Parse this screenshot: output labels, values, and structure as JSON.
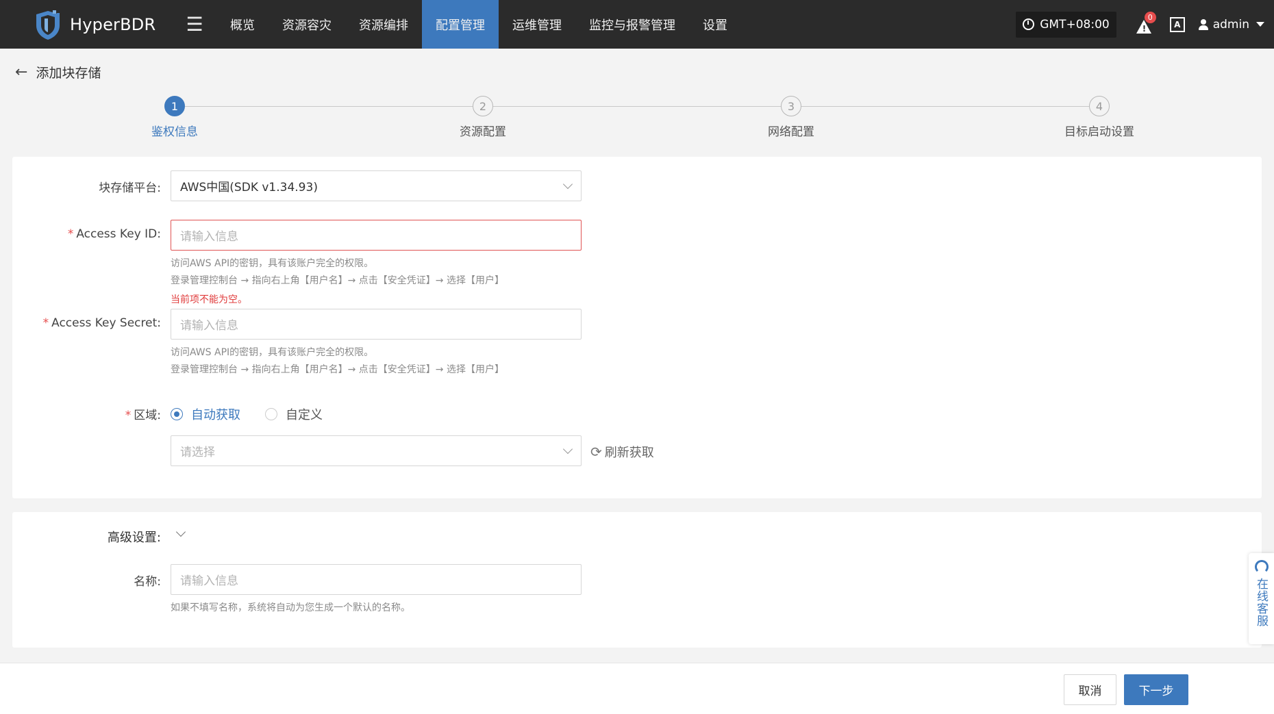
{
  "app": {
    "name": "HyperBDR"
  },
  "nav": {
    "items": [
      {
        "label": "概览",
        "active": false
      },
      {
        "label": "资源容灾",
        "active": false
      },
      {
        "label": "资源编排",
        "active": false
      },
      {
        "label": "配置管理",
        "active": true
      },
      {
        "label": "运维管理",
        "active": false
      },
      {
        "label": "监控与报警管理",
        "active": false
      },
      {
        "label": "设置",
        "active": false
      }
    ]
  },
  "header": {
    "timezone": "GMT+08:00",
    "alert_count": "0",
    "lang_icon": "A文",
    "user": "admin"
  },
  "page": {
    "title": "添加块存储"
  },
  "steps": [
    {
      "num": "1",
      "label": "鉴权信息",
      "active": true
    },
    {
      "num": "2",
      "label": "资源配置",
      "active": false
    },
    {
      "num": "3",
      "label": "网络配置",
      "active": false
    },
    {
      "num": "4",
      "label": "目标启动设置",
      "active": false
    }
  ],
  "form": {
    "platform": {
      "label": "块存储平台:",
      "value": "AWS中国(SDK v1.34.93)"
    },
    "access_key_id": {
      "label": "Access Key ID:",
      "placeholder": "请输入信息",
      "hint1": "访问AWS API的密钥，具有该账户完全的权限。",
      "hint2": "登录管理控制台 → 指向右上角【用户名】→ 点击【安全凭证】→ 选择【用户】",
      "error": "当前项不能为空。"
    },
    "access_key_secret": {
      "label": "Access Key Secret:",
      "placeholder": "请输入信息",
      "hint1": "访问AWS API的密钥，具有该账户完全的权限。",
      "hint2": "登录管理控制台 → 指向右上角【用户名】→ 点击【安全凭证】→ 选择【用户】"
    },
    "region": {
      "label": "区域:",
      "option_auto": "自动获取",
      "option_custom": "自定义",
      "selected": "自动获取",
      "placeholder": "请选择",
      "refresh": "刷新获取"
    },
    "advanced": {
      "label": "高级设置:",
      "name_label": "名称:",
      "name_placeholder": "请输入信息",
      "name_hint": "如果不填写名称，系统将自动为您生成一个默认的名称。"
    }
  },
  "footer": {
    "cancel": "取消",
    "next": "下一步"
  },
  "side": {
    "service": "在线客服"
  },
  "colors": {
    "primary": "#3d79bd",
    "topbar": "#2b2b2b",
    "error": "#e05252"
  }
}
